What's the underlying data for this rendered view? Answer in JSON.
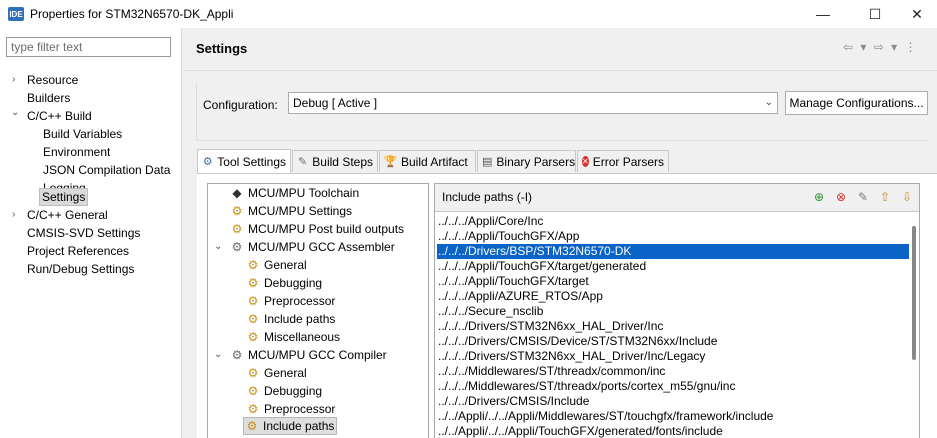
{
  "window": {
    "app_badge": "IDE",
    "title": "Properties for STM32N6570-DK_Appli",
    "minimize": "—",
    "maximize": "☐",
    "close": "✕"
  },
  "left": {
    "filter_placeholder": "type filter text",
    "tree": [
      {
        "label": "Resource",
        "chevron": "›"
      },
      {
        "label": "Builders",
        "chevron": ""
      },
      {
        "label": "C/C++ Build",
        "chevron": "⌄"
      },
      {
        "label": "Build Variables",
        "chevron": ""
      },
      {
        "label": "Environment",
        "chevron": ""
      },
      {
        "label": "JSON Compilation Datab",
        "chevron": ""
      },
      {
        "label": "Logging",
        "chevron": ""
      },
      {
        "label": "Settings",
        "chevron": ""
      },
      {
        "label": "C/C++ General",
        "chevron": "›"
      },
      {
        "label": "CMSIS-SVD Settings",
        "chevron": ""
      },
      {
        "label": "Project References",
        "chevron": ""
      },
      {
        "label": "Run/Debug Settings",
        "chevron": ""
      }
    ]
  },
  "main": {
    "title": "Settings",
    "nav_arrows": "⇦ ▾ ⇨ ▾ ⋮",
    "config_label": "Configuration:",
    "config_value": "Debug  [ Active ]",
    "config_dropdown": "⌄",
    "manage_button": "Manage Configurations...",
    "tabs": [
      {
        "label": "Tool Settings",
        "icon": "⚙"
      },
      {
        "label": "Build Steps",
        "icon": "✎"
      },
      {
        "label": "Build Artifact",
        "icon": "🏆"
      },
      {
        "label": "Binary Parsers",
        "icon": "▤"
      },
      {
        "label": "Error Parsers",
        "icon": "✕"
      }
    ],
    "tool_tree": [
      {
        "label": "MCU/MPU Toolchain",
        "chevron": ""
      },
      {
        "label": "MCU/MPU Settings",
        "chevron": ""
      },
      {
        "label": "MCU/MPU Post build outputs",
        "chevron": ""
      },
      {
        "label": "MCU/MPU GCC Assembler",
        "chevron": "⌄"
      },
      {
        "label": "General",
        "chevron": ""
      },
      {
        "label": "Debugging",
        "chevron": ""
      },
      {
        "label": "Preprocessor",
        "chevron": ""
      },
      {
        "label": "Include paths",
        "chevron": ""
      },
      {
        "label": "Miscellaneous",
        "chevron": ""
      },
      {
        "label": "MCU/MPU GCC Compiler",
        "chevron": "⌄"
      },
      {
        "label": "General",
        "chevron": ""
      },
      {
        "label": "Debugging",
        "chevron": ""
      },
      {
        "label": "Preprocessor",
        "chevron": ""
      },
      {
        "label": "Include paths",
        "chevron": ""
      }
    ],
    "include_title": "Include paths (-I)",
    "include_tools": [
      "add-icon",
      "delete-icon",
      "edit-icon",
      "move-up-icon",
      "move-down-icon"
    ],
    "paths": [
      "../../../Appli/Core/Inc",
      "../../../Appli/TouchGFX/App",
      "../../../Drivers/BSP/STM32N6570-DK",
      "../../../Appli/TouchGFX/target/generated",
      "../../../Appli/TouchGFX/target",
      "../../../Appli/AZURE_RTOS/App",
      "../../../Secure_nsclib",
      "../../../Drivers/STM32N6xx_HAL_Driver/Inc",
      "../../../Drivers/CMSIS/Device/ST/STM32N6xx/Include",
      "../../../Drivers/STM32N6xx_HAL_Driver/Inc/Legacy",
      "../../../Middlewares/ST/threadx/common/inc",
      "../../../Middlewares/ST/threadx/ports/cortex_m55/gnu/inc",
      "../../../Drivers/CMSIS/Include",
      "../../Appli/../../Appli/Middlewares/ST/touchgfx/framework/include",
      "../../Appli/../../Appli/TouchGFX/generated/fonts/include"
    ],
    "selected_path_index": 2
  }
}
